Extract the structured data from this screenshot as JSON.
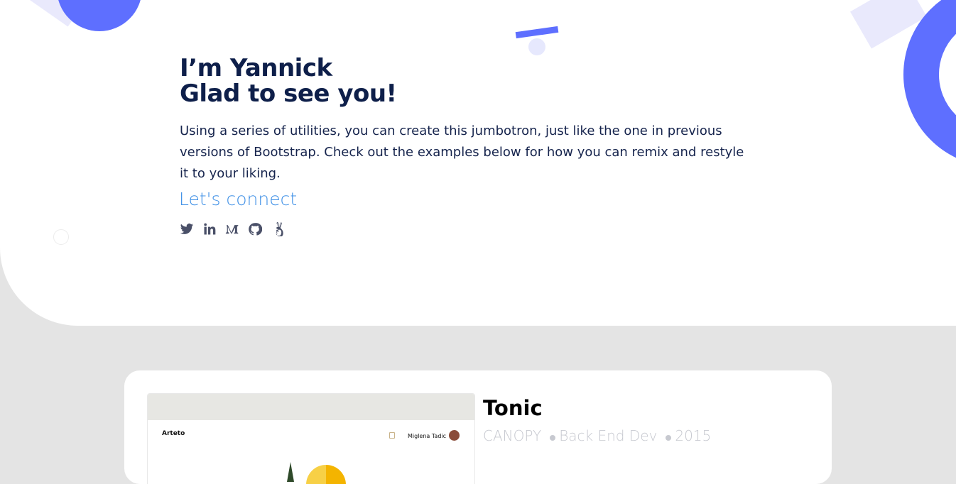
{
  "hero": {
    "title_line1": "I’m Yannick",
    "title_line2": "Glad to see you!",
    "description": "Using a series of utilities, you can create this jumbotron, just like the one in previous versions of Bootstrap. Check out the examples below for how you can remix and restyle it to your liking.",
    "connect_label": "Let's connect",
    "socials": [
      "twitter-icon",
      "linkedin-icon",
      "medium-icon",
      "github-icon",
      "angellist-icon"
    ]
  },
  "project": {
    "title": "Tonic",
    "client": "CANOPY",
    "role": "Back End Dev",
    "year": "2015",
    "preview": {
      "brand": "Arteto",
      "user": "Miglena Tadic"
    }
  },
  "colors": {
    "accent": "#5e6fff",
    "heading": "#0e1f4a",
    "link": "#3d8fe6",
    "muted": "#c7c9d0",
    "page_bg": "#e4e4e4"
  }
}
